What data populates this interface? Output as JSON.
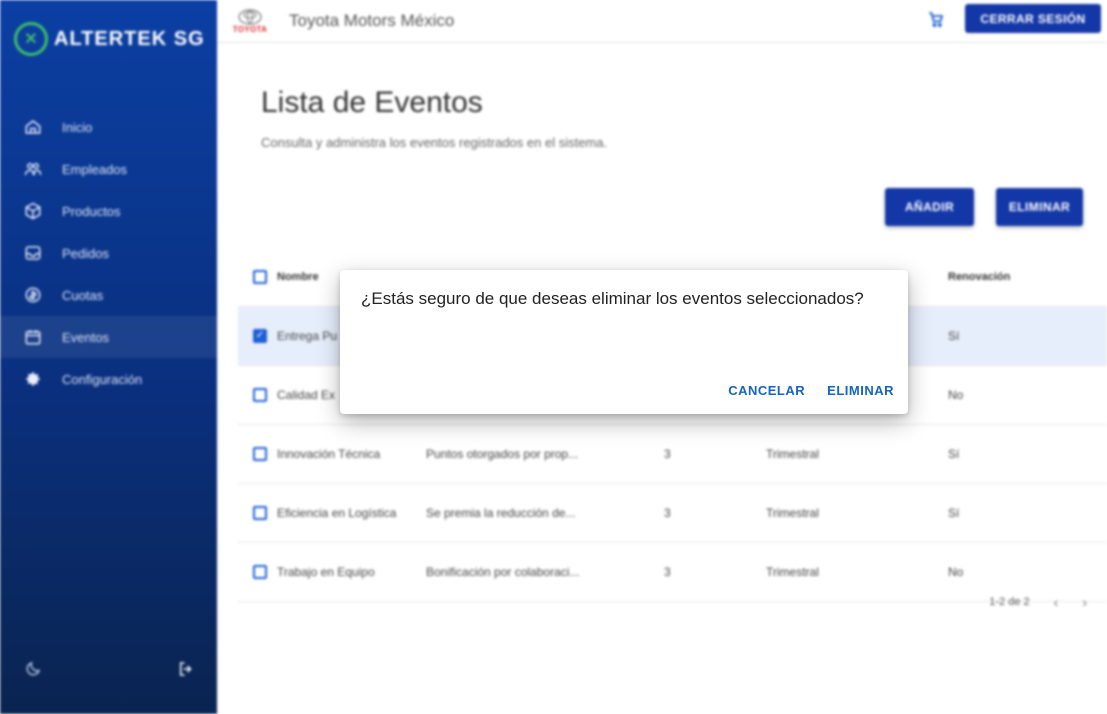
{
  "sidebar": {
    "logo_text": "ALTERTEK SG",
    "items": [
      {
        "label": "Inicio",
        "icon": "home-icon"
      },
      {
        "label": "Empleados",
        "icon": "people-icon"
      },
      {
        "label": "Productos",
        "icon": "box-icon"
      },
      {
        "label": "Pedidos",
        "icon": "inbox-icon"
      },
      {
        "label": "Cuotas",
        "icon": "coin-icon"
      },
      {
        "label": "Eventos",
        "icon": "calendar-icon",
        "active": true
      },
      {
        "label": "Configuración",
        "icon": "gear-icon"
      }
    ]
  },
  "header": {
    "brand": "TOYOTA",
    "title": "Toyota Motors México",
    "logout": "CERRAR SESIÓN"
  },
  "page": {
    "title": "Lista de Eventos",
    "subtitle": "Consulta y administra los eventos registrados en el sistema.",
    "add_button": "AÑADIR",
    "delete_button": "ELIMINAR"
  },
  "table": {
    "headers": [
      "Nombre",
      "",
      "",
      "",
      "Renovación"
    ],
    "rows": [
      {
        "name": "Entrega Pu",
        "description": "",
        "points": "",
        "period": "",
        "renewal": "Sí",
        "checked": true
      },
      {
        "name": "Calidad Ex",
        "description": "",
        "points": "",
        "period": "",
        "renewal": "No",
        "checked": false
      },
      {
        "name": "Innovación Técnica",
        "description": "Puntos otorgados por prop...",
        "points": "3",
        "period": "Trimestral",
        "renewal": "Sí",
        "checked": false
      },
      {
        "name": "Eficiencia en Logística",
        "description": "Se premia la reducción de...",
        "points": "3",
        "period": "Trimestral",
        "renewal": "Sí",
        "checked": false
      },
      {
        "name": "Trabajo en Equipo",
        "description": "Bonificación por colaboraci...",
        "points": "3",
        "period": "Trimestral",
        "renewal": "No",
        "checked": false
      }
    ],
    "pagination": "1-2 de 2"
  },
  "dialog": {
    "message": "¿Estás seguro de que deseas eliminar los eventos seleccionados?",
    "cancel": "CANCELAR",
    "confirm": "ELIMINAR"
  },
  "colors": {
    "primary": "#1437a8",
    "sidebar_top": "#0b3fa3",
    "sidebar_bottom": "#0a2450",
    "dialog_action": "#1565c0",
    "selected_row": "#e6eefc"
  }
}
